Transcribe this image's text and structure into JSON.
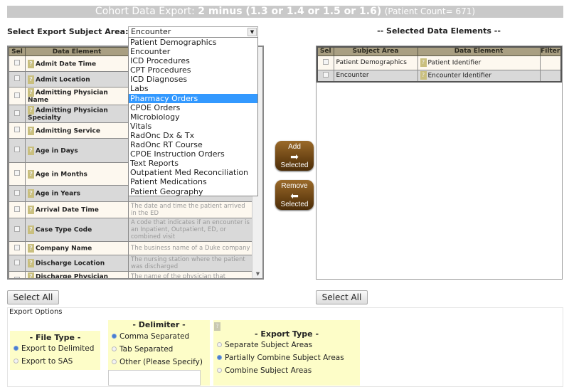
{
  "title": {
    "prefix": "Cohort Data Export:",
    "cohort": "2 minus (1.3 or 1.4 or 1.5 or 1.6)",
    "count": "(Patient Count= 671)"
  },
  "subject_area": {
    "label": "Select Export Subject Area:",
    "selected": "Encounter",
    "highlighted": "Pharmacy Orders",
    "options": [
      "Patient Demographics",
      "Encounter",
      "ICD Procedures",
      "CPT Procedures",
      "ICD Diagnoses",
      "Labs",
      "Pharmacy Orders",
      "CPOE Orders",
      "Microbiology",
      "Vitals",
      "RadOnc Dx & Tx",
      "RadOnc RT Course",
      "CPOE Instruction Orders",
      "Text Reports",
      "Outpatient Med Reconciliation",
      "Patient Medications",
      "Patient Geography"
    ]
  },
  "available": {
    "headers": {
      "sel": "Sel",
      "element": "Data Element"
    },
    "rows": [
      {
        "name": "Admit Date Time",
        "desc": ""
      },
      {
        "name": "Admit Location",
        "desc": ""
      },
      {
        "name": "Admitting Physician Name",
        "desc": ""
      },
      {
        "name": "Admitting Physician Specialty",
        "desc": ""
      },
      {
        "name": "Admitting Service",
        "desc": ""
      },
      {
        "name": "Age in Days",
        "desc": ""
      },
      {
        "name": "Age in Months",
        "desc": ""
      },
      {
        "name": "Age in Years",
        "desc": ""
      },
      {
        "name": "Arrival Date Time",
        "desc": "The date and time the patient arrived in the ED"
      },
      {
        "name": "Case Type Code",
        "desc": "A code that indicates if an encounter is an Inpatient, Outpatient, ED, or combined visit"
      },
      {
        "name": "Company Name",
        "desc": "The business name of a Duke company"
      },
      {
        "name": "Discharge Location",
        "desc": "The nursing station where the patient was discharged"
      },
      {
        "name": "Discharge Physician Name",
        "desc": "The name of the physician that discharged the patient"
      }
    ],
    "select_all": "Select All"
  },
  "selected": {
    "heading": "-- Selected Data Elements --",
    "headers": {
      "sel": "Sel",
      "subject": "Subject Area",
      "element": "Data Element",
      "filter": "Filter"
    },
    "rows": [
      {
        "subject": "Patient Demographics",
        "element": "Patient Identifier"
      },
      {
        "subject": "Encounter",
        "element": "Encounter Identifier"
      }
    ],
    "select_all": "Select All"
  },
  "buttons": {
    "add_top": "Add",
    "add_bottom": "Selected",
    "remove_top": "Remove",
    "remove_bottom": "Selected"
  },
  "export_options": {
    "title": "Export Options",
    "file_type": {
      "heading": "- File Type -",
      "options": [
        "Export to Delimited",
        "Export to SAS"
      ],
      "selected": "Export to Delimited"
    },
    "delimiter": {
      "heading": "- Delimiter -",
      "options": [
        "Comma Separated",
        "Tab Separated",
        "Other (Please Specify)"
      ],
      "selected": "Comma Separated",
      "other_value": ""
    },
    "export_type": {
      "heading": "- Export Type -",
      "options": [
        "Separate Subject Areas",
        "Partially Combine Subject Areas",
        "Combine Subject Areas"
      ],
      "selected": "Partially Combine Subject Areas"
    }
  },
  "colors": {
    "header": "#a99f82",
    "row_odd": "#fdf8ef",
    "row_even": "#d9d9d9",
    "button": "#6b4414",
    "options_bg": "#fdfdc8",
    "highlight": "#3399ff"
  }
}
